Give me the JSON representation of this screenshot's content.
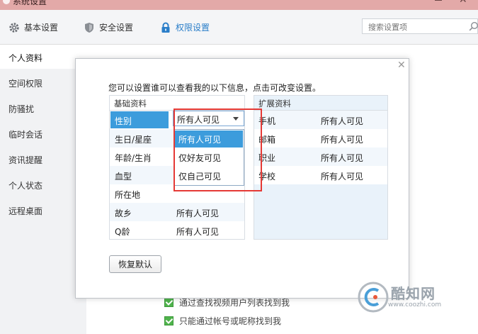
{
  "window": {
    "title": "系统设置"
  },
  "tabs": [
    {
      "label": "基本设置",
      "icon": "gear-icon"
    },
    {
      "label": "安全设置",
      "icon": "shield-icon"
    },
    {
      "label": "权限设置",
      "icon": "lock-icon"
    }
  ],
  "search": {
    "placeholder": "搜索设置项"
  },
  "sidebar": {
    "items": [
      "个人资料",
      "空间权限",
      "防骚扰",
      "临时会话",
      "资讯提醒",
      "个人状态",
      "远程桌面"
    ]
  },
  "background_options": [
    {
      "label": "通过查找视频用户列表找到我",
      "checked": true
    },
    {
      "label": "只能通过帐号或昵称找到我",
      "checked": true
    }
  ],
  "dialog": {
    "intro": "您可以设置谁可以查看我的以下信息，点击可改变设置。",
    "basic": {
      "title": "基础资料",
      "rows": [
        {
          "key": "性别",
          "value": ""
        },
        {
          "key": "生日/星座",
          "value": ""
        },
        {
          "key": "年龄/生肖",
          "value": ""
        },
        {
          "key": "血型",
          "value": ""
        },
        {
          "key": "所在地",
          "value": ""
        },
        {
          "key": "故乡",
          "value": "所有人可见"
        },
        {
          "key": "Q龄",
          "value": "所有人可见"
        }
      ]
    },
    "extended": {
      "title": "扩展资料",
      "rows": [
        {
          "key": "手机",
          "value": "所有人可见"
        },
        {
          "key": "邮箱",
          "value": "所有人可见"
        },
        {
          "key": "职业",
          "value": "所有人可见"
        },
        {
          "key": "学校",
          "value": "所有人可见"
        }
      ]
    },
    "select": {
      "value": "所有人可见",
      "options": [
        "所有人可见",
        "仅好友可见",
        "仅自己可见"
      ],
      "selected_index": 0
    },
    "restore_button": "恢复默认"
  },
  "watermark": {
    "text": "酷知网",
    "url": "www.coozhi.com"
  },
  "colors": {
    "accent": "#3c9cdc",
    "titlebar": "#e3a9a8",
    "highlight": "#e53935",
    "check": "#4fb34c"
  }
}
